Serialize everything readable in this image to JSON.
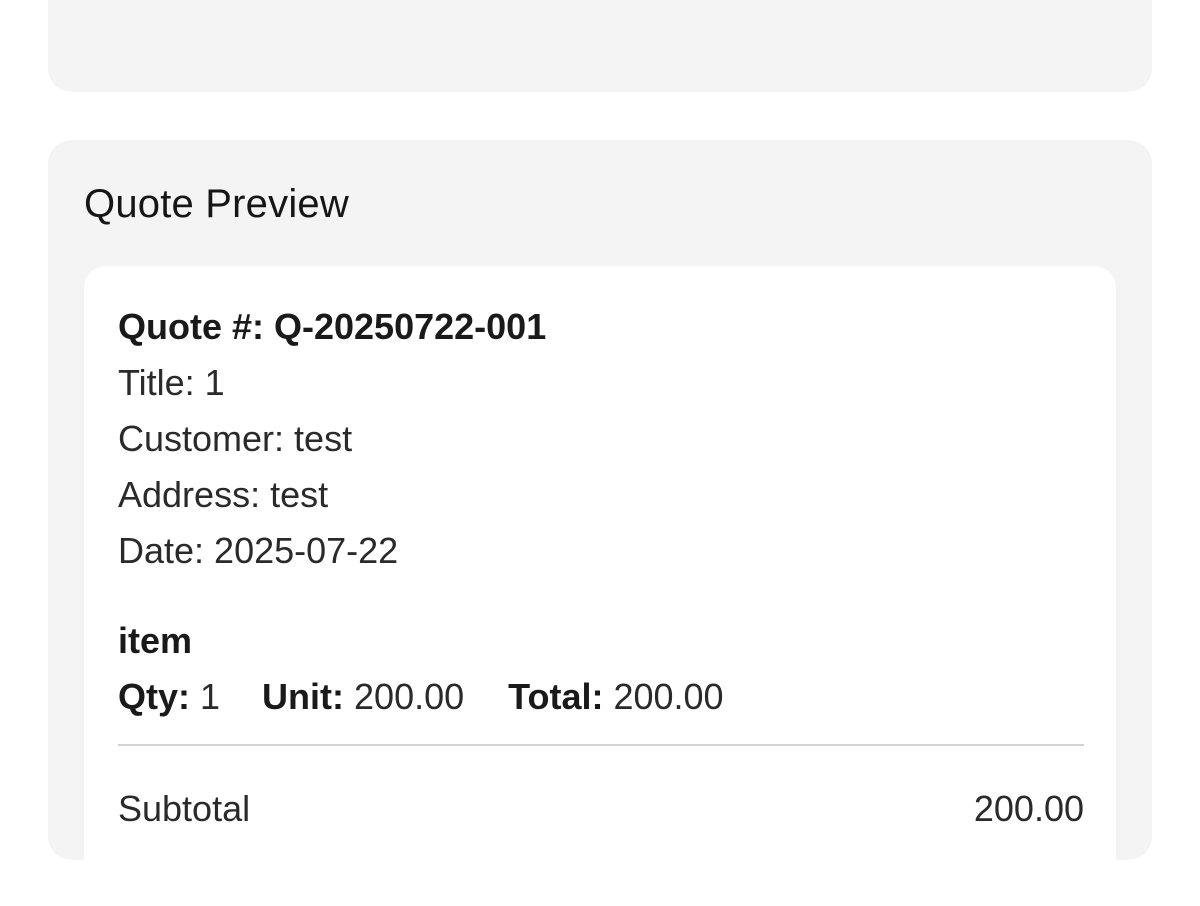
{
  "preview": {
    "heading": "Quote Preview",
    "quote_number": "Quote #: Q-20250722-001",
    "title": "Title: 1",
    "customer": "Customer: test",
    "address": "Address: test",
    "date": "Date: 2025-07-22",
    "item": {
      "name": "item",
      "qty_label": "Qty:",
      "qty_value": "1",
      "unit_label": "Unit:",
      "unit_value": "200.00",
      "total_label": "Total:",
      "total_value": "200.00"
    },
    "subtotal_label": "Subtotal",
    "subtotal_value": "200.00"
  }
}
